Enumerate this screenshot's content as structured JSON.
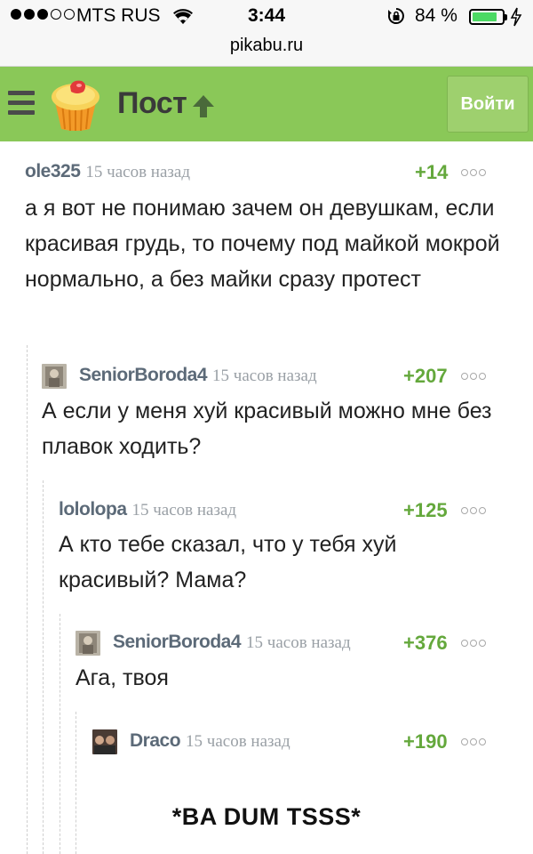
{
  "status_bar": {
    "carrier": "MTS RUS",
    "time": "3:44",
    "battery_percent_text": "84 %",
    "battery_level": 0.84,
    "url": "pikabu.ru"
  },
  "header": {
    "title": "Пост",
    "login_label": "Войти",
    "accent_color": "#8ac858"
  },
  "comments": [
    {
      "author": "ole325",
      "time": "15 часов назад",
      "rating": "+14",
      "text": "а я вот не понимаю зачем он девушкам, если красивая грудь, то почему под майкой мокрой нормально, а без майки сразу протест",
      "has_avatar": false
    },
    {
      "author": "SeniorBoroda4",
      "time": "15 часов назад",
      "rating": "+207",
      "text": "А если у меня хуй красивый можно мне без плавок ходить?",
      "has_avatar": true
    },
    {
      "author": "lololopa",
      "time": "15 часов назад",
      "rating": "+125",
      "text": "А кто тебе сказал, что у тебя хуй красивый? Мама?",
      "has_avatar": false
    },
    {
      "author": "SeniorBoroda4",
      "time": "15 часов назад",
      "rating": "+376",
      "text": "Ага, твоя",
      "has_avatar": true
    },
    {
      "author": "Draco",
      "time": "15 часов назад",
      "rating": "+190",
      "text": "",
      "has_avatar": true
    }
  ],
  "caption": "*BA DUM TSSS*",
  "icons": [
    "signal-dots-icon",
    "wifi-icon",
    "rotation-lock-icon",
    "battery-icon",
    "charging-icon",
    "menu-icon",
    "cupcake-logo-icon",
    "up-arrow-icon",
    "more-options-icon",
    "avatar"
  ]
}
